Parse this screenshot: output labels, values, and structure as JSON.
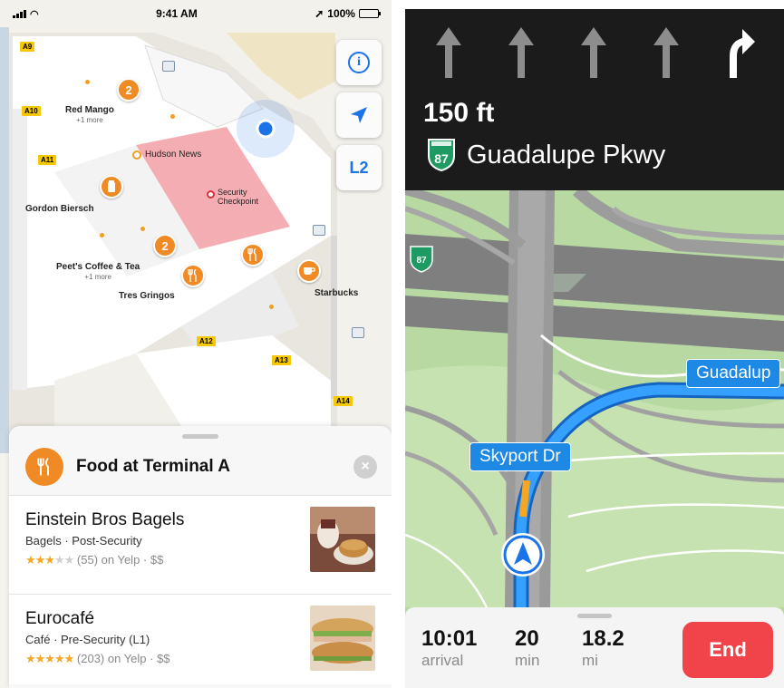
{
  "left": {
    "status": {
      "time": "9:41 AM",
      "battery": "100%",
      "battery_level": 1.0
    },
    "map": {
      "gates": [
        "A9",
        "A10",
        "A11",
        "A12",
        "A13",
        "A14"
      ],
      "pois": {
        "red_mango": {
          "name": "Red Mango",
          "sub": "+1 more"
        },
        "hudson_news": "Hudson News",
        "security": "Security Checkpoint",
        "gordon_biersch": "Gordon Biersch",
        "peets": {
          "name": "Peet's Coffee & Tea",
          "sub": "+1 more"
        },
        "tres_gringos": "Tres Gringos",
        "starbucks": "Starbucks"
      },
      "clusters": [
        "2",
        "2"
      ]
    },
    "controls": {
      "info": "i",
      "floor": "L2"
    },
    "sheet": {
      "title": "Food at Terminal A",
      "close": "×",
      "results": [
        {
          "name": "Einstein Bros Bagels",
          "subtitle": "Bagels · Post-Security",
          "rating": 3,
          "stars_on": "★★★",
          "stars_off": "★★",
          "reviews": "(55) on Yelp · $$"
        },
        {
          "name": "Eurocafé",
          "subtitle": "Café · Pre-Security (L1)",
          "rating": 4.5,
          "stars_on": "★★★★★",
          "stars_off": "",
          "reviews": "(203) on Yelp · $$"
        }
      ]
    },
    "colors": {
      "accent": "#f08a24",
      "control_blue": "#1a73e8",
      "gate_yellow": "#f5c800",
      "security_pink": "#f2a0a6"
    }
  },
  "right": {
    "guidance": {
      "distance": "150 ft",
      "route_shield": "87",
      "street": "Guadalupe Pkwy"
    },
    "map": {
      "shield": "87",
      "labels": {
        "skyport": "Skyport Dr",
        "guadalupe": "Guadalup"
      }
    },
    "trip": {
      "arrival_value": "10:01",
      "arrival_label": "arrival",
      "duration_value": "20",
      "duration_label": "min",
      "distance_value": "18.2",
      "distance_label": "mi",
      "end": "End"
    },
    "colors": {
      "route_blue": "#1e88e5",
      "end_red": "#f0434a",
      "guidance_bg": "#1b1b1b",
      "shield_green": "#1e9a63"
    }
  }
}
